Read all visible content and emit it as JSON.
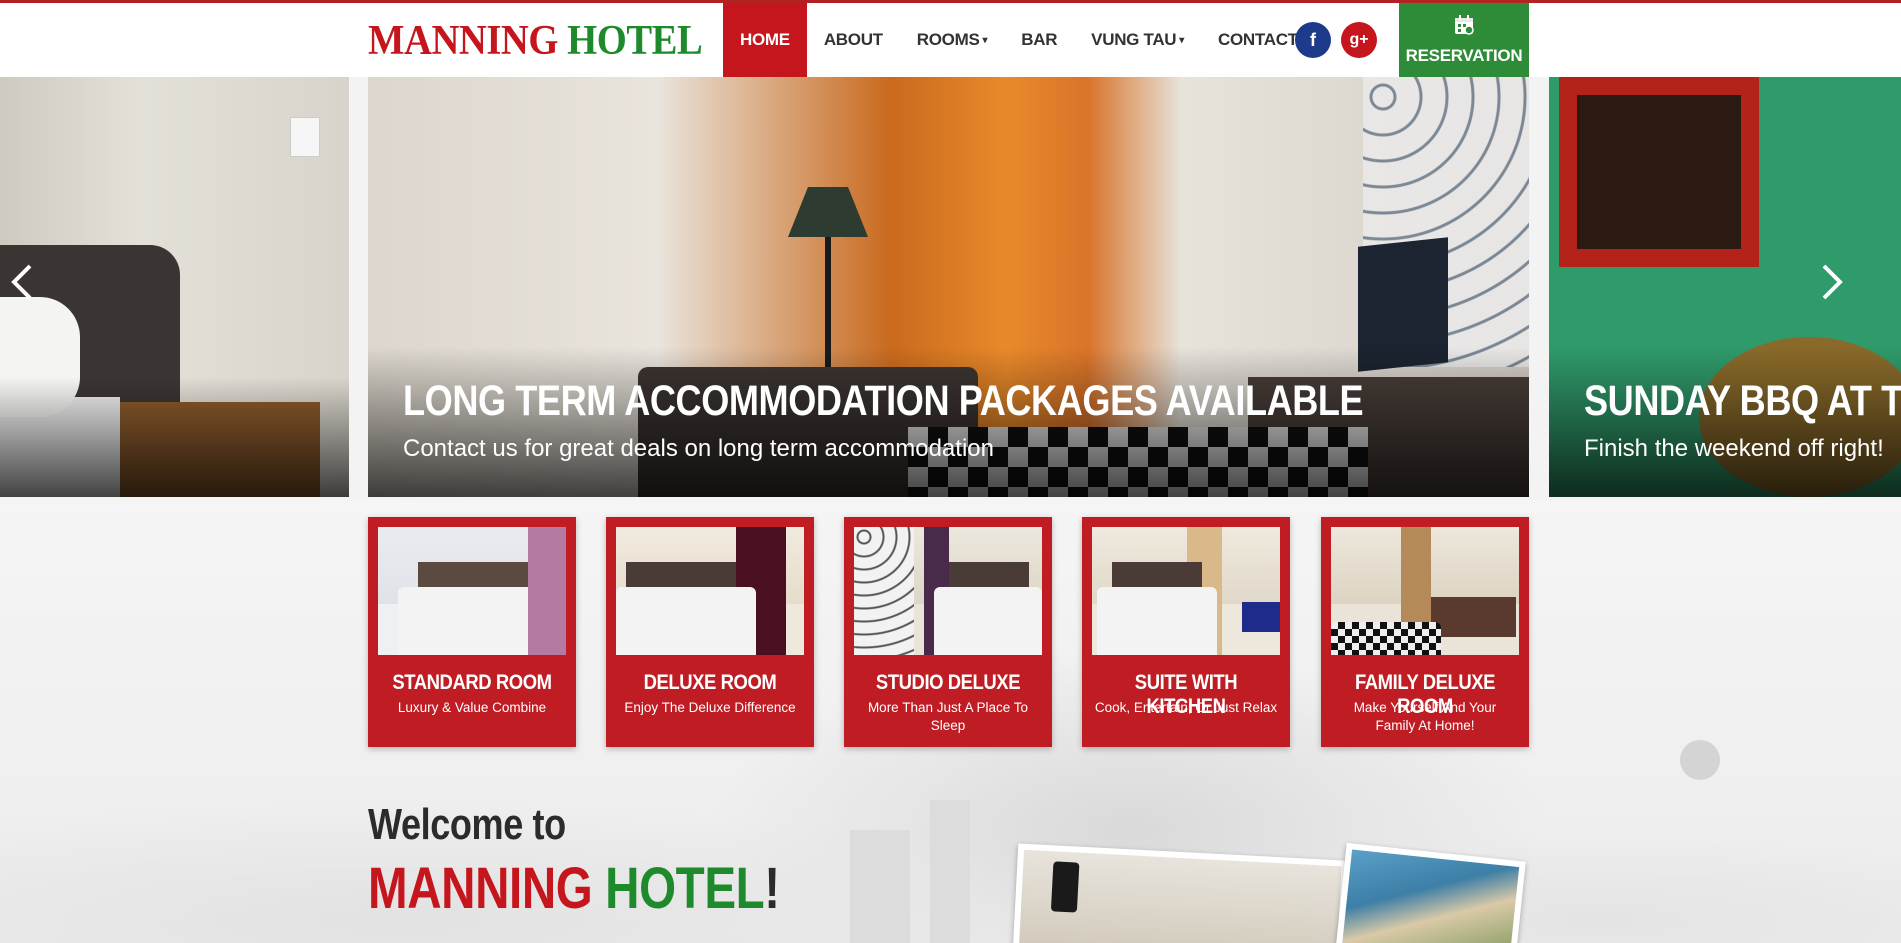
{
  "header": {
    "logo_part1": "MANNING",
    "logo_part2": "HOTEL",
    "nav": [
      {
        "label": "HOME",
        "active": true
      },
      {
        "label": "ABOUT"
      },
      {
        "label": "ROOMS",
        "dropdown": true
      },
      {
        "label": "BAR"
      },
      {
        "label": "VUNG TAU",
        "dropdown": true
      },
      {
        "label": "CONTACT"
      }
    ],
    "facebook_glyph": "f",
    "google_glyph": "g+",
    "reservation_label": "RESERVATION",
    "caret": "▾"
  },
  "slider": {
    "prev_arrow": "‹",
    "next_arrow": "›",
    "center_title": "LONG TERM ACCOMMODATION PACKAGES AVAILABLE",
    "center_subtitle": "Contact us for great deals on long term accommodation",
    "right_title": "SUNDAY BBQ AT TH",
    "right_subtitle": "Finish the weekend off right!"
  },
  "rooms": [
    {
      "name": "STANDARD ROOM",
      "desc": "Luxury & Value Combine"
    },
    {
      "name": "DELUXE ROOM",
      "desc": "Enjoy The Deluxe Difference"
    },
    {
      "name": "STUDIO DELUXE",
      "desc": "More Than Just A Place To Sleep"
    },
    {
      "name": "SUITE WITH KITCHEN",
      "desc": "Cook, Entertain, Or Just Relax"
    },
    {
      "name": "FAMILY DELUXE ROOM",
      "desc": "Make Yourself And Your Family At Home!"
    }
  ],
  "welcome": {
    "line1": "Welcome to",
    "brand1": "MANNING",
    "brand2": "HOTEL",
    "excl": "!"
  },
  "colors": {
    "brand_red": "#c4161c",
    "brand_green": "#1f8a2b",
    "facebook_blue": "#1e3a8a"
  },
  "icons": [
    "facebook-icon",
    "google-plus-icon",
    "calendar-icon",
    "chevron-left-icon",
    "chevron-right-icon"
  ]
}
